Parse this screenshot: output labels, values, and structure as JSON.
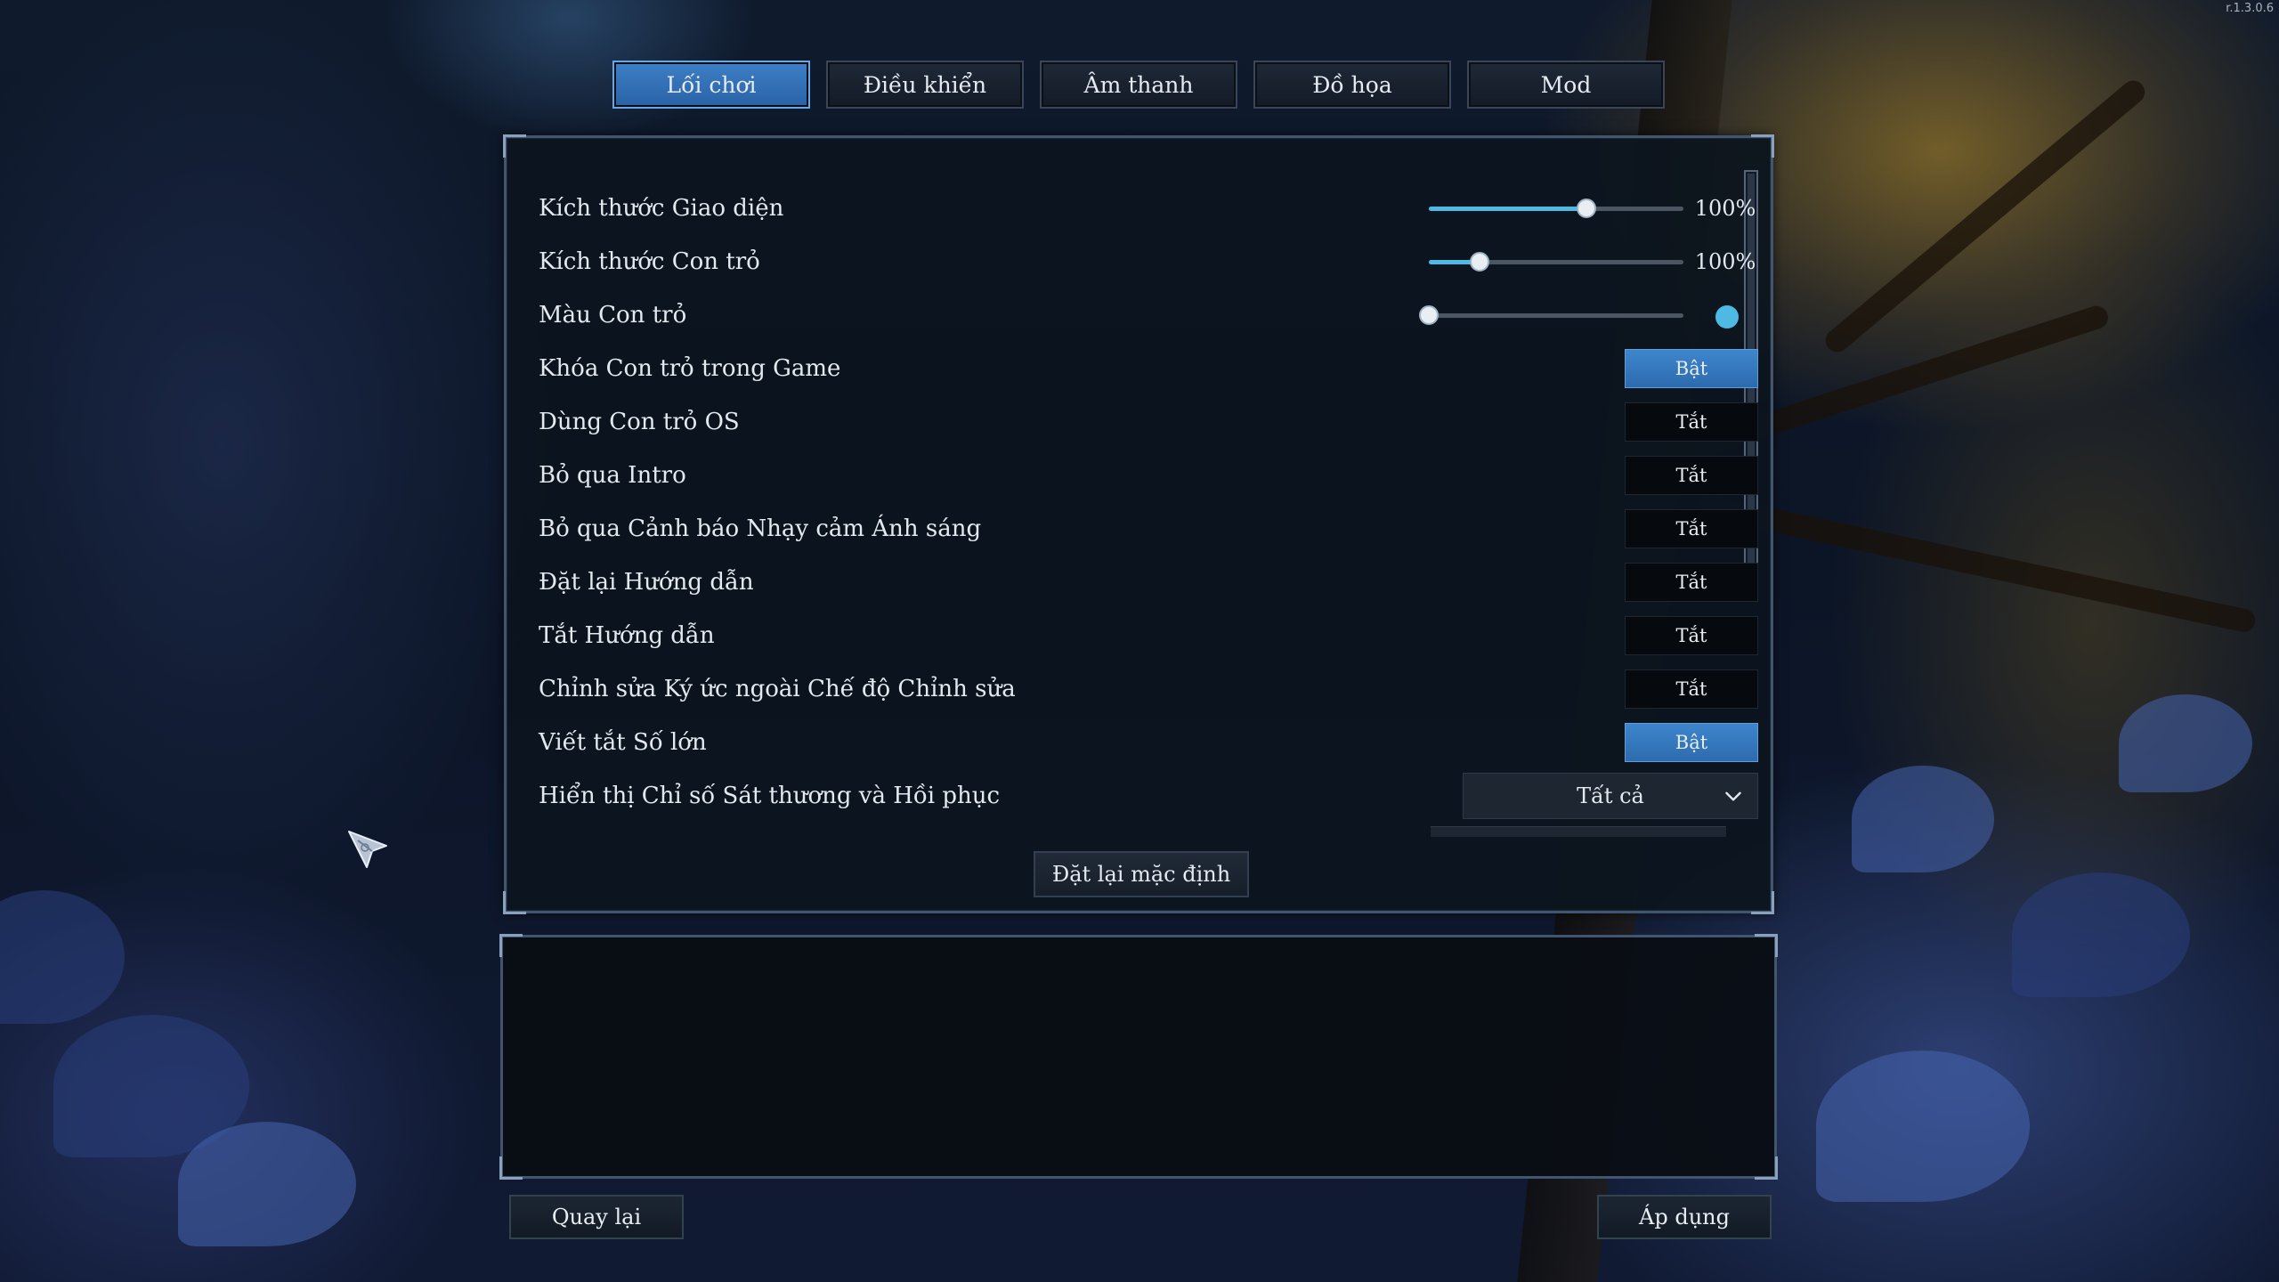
{
  "version": "r.1.3.0.6",
  "tabs": [
    {
      "label": "Lối chơi",
      "active": true
    },
    {
      "label": "Điều khiển",
      "active": false
    },
    {
      "label": "Âm thanh",
      "active": false
    },
    {
      "label": "Đồ họa",
      "active": false
    },
    {
      "label": "Mod",
      "active": false
    }
  ],
  "settings": {
    "ui_scale": {
      "label": "Kích thước Giao diện",
      "value_text": "100%",
      "level": 0.62
    },
    "cursor_size": {
      "label": "Kích thước Con trỏ",
      "value_text": "100%",
      "level": 0.2
    },
    "cursor_color": {
      "label": "Màu Con trỏ",
      "level": 0.0,
      "swatch_color": "#4fb9e6"
    },
    "lock_cursor": {
      "label": "Khóa Con trỏ trong Game",
      "state": "Bật"
    },
    "os_cursor": {
      "label": "Dùng Con trỏ OS",
      "state": "Tắt"
    },
    "skip_intro": {
      "label": "Bỏ qua Intro",
      "state": "Tắt"
    },
    "skip_photo_warning": {
      "label": "Bỏ qua Cảnh báo Nhạy cảm Ánh sáng",
      "state": "Tắt"
    },
    "reset_tutorial": {
      "label": "Đặt lại Hướng dẫn",
      "state": "Tắt"
    },
    "disable_tutorial": {
      "label": "Tắt Hướng dẫn",
      "state": "Tắt"
    },
    "edit_memories": {
      "label": "Chỉnh sửa Ký ức ngoài Chế độ Chỉnh sửa",
      "state": "Tắt"
    },
    "abbreviate_numbers": {
      "label": "Viết tắt Số lớn",
      "state": "Bật"
    },
    "damage_numbers": {
      "label": "Hiển thị Chỉ số Sát thương và Hồi phục",
      "selected": "Tất cả"
    }
  },
  "buttons": {
    "reset_defaults": "Đặt lại mặc định",
    "back": "Quay lại",
    "apply": "Áp dụng"
  },
  "colors": {
    "accent": "#3e86cc",
    "slider_fill": "#4fb9e6"
  }
}
